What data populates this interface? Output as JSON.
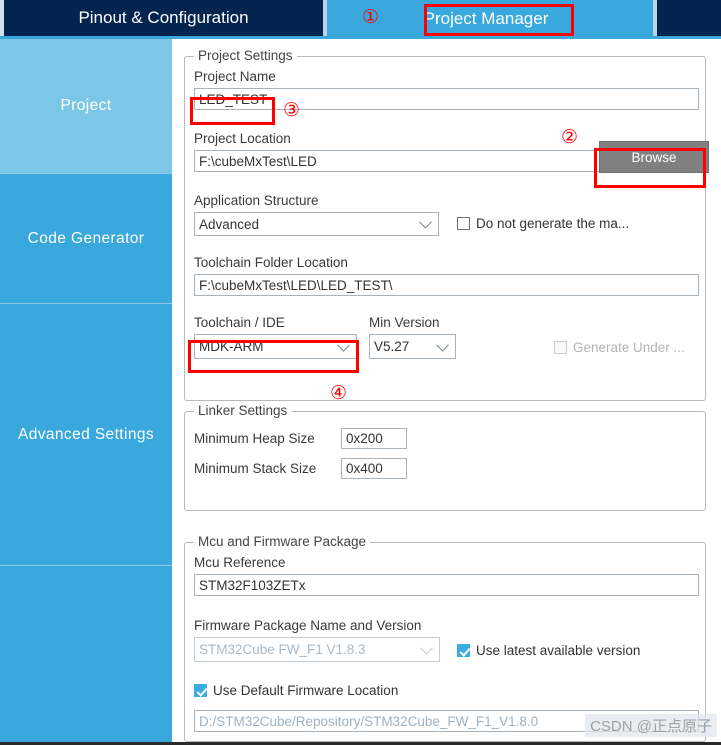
{
  "window": {
    "tabs": [
      {
        "label": "Pinout & Configuration",
        "active": false
      },
      {
        "label": "Project Manager",
        "active": true
      }
    ]
  },
  "sidebar": {
    "items": [
      {
        "label": "Project",
        "selected": true
      },
      {
        "label": "Code Generator",
        "selected": false
      },
      {
        "label": "Advanced Settings",
        "selected": false
      },
      {
        "label": "",
        "selected": false
      }
    ]
  },
  "project_settings": {
    "group_title": "Project Settings",
    "project_name_label": "Project Name",
    "project_name_value": "LED_TEST",
    "project_location_label": "Project Location",
    "project_location_value": "F:\\cubeMxTest\\LED",
    "browse_button": "Browse",
    "application_structure_label": "Application Structure",
    "application_structure_value": "Advanced",
    "do_not_generate_label": "Do not generate the ma...",
    "do_not_generate_checked": false,
    "toolchain_folder_label": "Toolchain Folder Location",
    "toolchain_folder_value": "F:\\cubeMxTest\\LED\\LED_TEST\\",
    "toolchain_ide_label": "Toolchain / IDE",
    "toolchain_ide_value": "MDK-ARM",
    "min_version_label": "Min Version",
    "min_version_value": "V5.27",
    "generate_under_label": "Generate Under ...",
    "generate_under_checked": false
  },
  "linker_settings": {
    "group_title": "Linker Settings",
    "min_heap_label": "Minimum Heap Size",
    "min_heap_value": "0x200",
    "min_stack_label": "Minimum Stack Size",
    "min_stack_value": "0x400"
  },
  "mcu_firmware": {
    "group_title": "Mcu and Firmware Package",
    "mcu_reference_label": "Mcu Reference",
    "mcu_reference_value": "STM32F103ZETx",
    "firmware_package_label": "Firmware Package Name and Version",
    "firmware_package_value": "STM32Cube FW_F1 V1.8.3",
    "use_latest_label": "Use latest available version",
    "use_latest_checked": true,
    "use_default_location_label": "Use Default Firmware Location",
    "use_default_location_checked": true,
    "firmware_location_value": "D:/STM32Cube/Repository/STM32Cube_FW_F1_V1.8.0"
  },
  "annotations": {
    "markers": [
      "①",
      "②",
      "③",
      "④"
    ]
  },
  "watermark": {
    "text": "CSDN @正点原子"
  },
  "colors": {
    "tab_dark": "#042450",
    "tab_active": "#38a8dd",
    "sidebar": "#38a8dd",
    "sidebar_selected": "#7cc6e8",
    "annotation_red": "#ff0000",
    "accent_check": "#3cabe0"
  }
}
